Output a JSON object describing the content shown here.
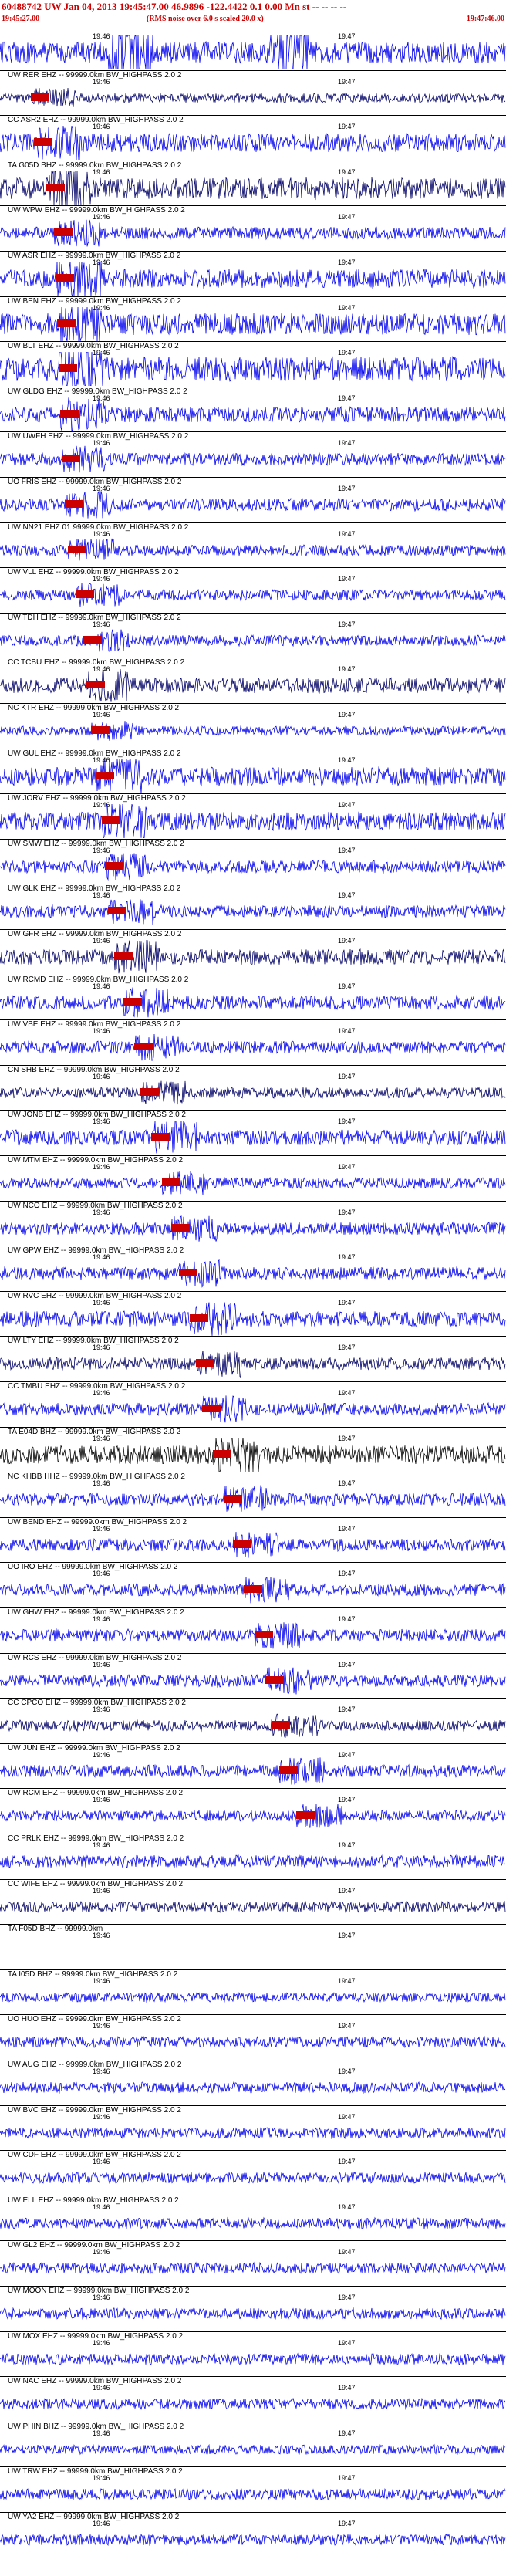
{
  "header": {
    "line1": "60488742 UW Jan 04, 2013 19:45:47.00   46.9896 -122.4422  0.1 0.00 Mn st -- -- -- --",
    "start_time": "19:45:27.00",
    "note": "(RMS noise over 6.0 s scaled 20.0 x)",
    "end_time": "19:47:46.00"
  },
  "tick_left": "19:46",
  "tick_right": "19:47",
  "colors": {
    "header_red": "#cc0000",
    "trace_blue": "#0000ee",
    "trace_navy": "#000066",
    "trace_black": "#000000",
    "pick_red": "#cc0000"
  },
  "stations": [
    {
      "label": "",
      "color": "#0000ee"
    },
    {
      "label": "UW RER EHZ -- 99999.0km BW_HIGHPASS  2.0  2",
      "color": "#000066"
    },
    {
      "label": "CC ASR2 EHZ -- 99999.0km BW_HIGHPASS  2.0  2",
      "color": "#0000ee"
    },
    {
      "label": "TA G05D BHZ -- 99999.0km BW_HIGHPASS  2.0  2",
      "color": "#000066"
    },
    {
      "label": "UW WPW EHZ -- 99999.0km BW_HIGHPASS  2.0  2",
      "color": "#0000ee"
    },
    {
      "label": "UW ASR EHZ -- 99999.0km BW_HIGHPASS  2.0  2",
      "color": "#0000ee"
    },
    {
      "label": "UW BEN EHZ -- 99999.0km BW_HIGHPASS  2.0  2",
      "color": "#0000ee"
    },
    {
      "label": "UW BLT EHZ -- 99999.0km BW_HIGHPASS  2.0  2",
      "color": "#0000ee"
    },
    {
      "label": "UW GLDG EHZ -- 99999.0km BW_HIGHPASS  2.0  2",
      "color": "#0000ee"
    },
    {
      "label": "UW UWFH EHZ -- 99999.0km BW_HIGHPASS  2.0  2",
      "color": "#0000ee"
    },
    {
      "label": "UO FRIS EHZ -- 99999.0km BW_HIGHPASS  2.0  2",
      "color": "#0000ee"
    },
    {
      "label": "UW NN21 EHZ 01 99999.0km BW_HIGHPASS  2.0  2",
      "color": "#0000ee"
    },
    {
      "label": "UW VLL EHZ -- 99999.0km BW_HIGHPASS  2.0  2",
      "color": "#0000ee"
    },
    {
      "label": "UW TDH EHZ -- 99999.0km BW_HIGHPASS  2.0  2",
      "color": "#0000ee"
    },
    {
      "label": "CC TCBU EHZ -- 99999.0km BW_HIGHPASS  2.0  2",
      "color": "#000066"
    },
    {
      "label": "NC KTR EHZ -- 99999.0km BW_HIGHPASS  2.0  2",
      "color": "#0000ee"
    },
    {
      "label": "UW GUL EHZ -- 99999.0km BW_HIGHPASS  2.0  2",
      "color": "#0000ee"
    },
    {
      "label": "UW JORV EHZ -- 99999.0km BW_HIGHPASS  2.0  2",
      "color": "#0000ee"
    },
    {
      "label": "UW SMW EHZ -- 99999.0km BW_HIGHPASS  2.0  2",
      "color": "#0000ee"
    },
    {
      "label": "UW GLK EHZ -- 99999.0km BW_HIGHPASS  2.0  2",
      "color": "#0000ee"
    },
    {
      "label": "UW GFR EHZ -- 99999.0km BW_HIGHPASS  2.0  2",
      "color": "#000066"
    },
    {
      "label": "UW RCMD EHZ -- 99999.0km BW_HIGHPASS  2.0  2",
      "color": "#0000ee"
    },
    {
      "label": "UW VBE EHZ -- 99999.0km BW_HIGHPASS  2.0  2",
      "color": "#0000ee"
    },
    {
      "label": "CN SHB EHZ -- 99999.0km BW_HIGHPASS  2.0  2",
      "color": "#000066"
    },
    {
      "label": "UW JONB EHZ -- 99999.0km BW_HIGHPASS  2.0  2",
      "color": "#0000ee"
    },
    {
      "label": "UW MTM EHZ -- 99999.0km BW_HIGHPASS  2.0  2",
      "color": "#0000ee"
    },
    {
      "label": "UW NCO EHZ -- 99999.0km BW_HIGHPASS  2.0  2",
      "color": "#0000ee"
    },
    {
      "label": "UW GPW EHZ -- 99999.0km BW_HIGHPASS  2.0  2",
      "color": "#0000ee"
    },
    {
      "label": "UW RVC EHZ -- 99999.0km BW_HIGHPASS  2.0  2",
      "color": "#0000ee"
    },
    {
      "label": "UW LTY EHZ -- 99999.0km BW_HIGHPASS  2.0  2",
      "color": "#000066"
    },
    {
      "label": "CC TMBU EHZ -- 99999.0km BW_HIGHPASS  2.0  2",
      "color": "#0000ee"
    },
    {
      "label": "TA E04D BHZ -- 99999.0km BW_HIGHPASS  2.0  2",
      "color": "#000000"
    },
    {
      "label": "NC KHBB HHZ -- 99999.0km BW_HIGHPASS  2.0  2",
      "color": "#0000ee"
    },
    {
      "label": "UW BEND EHZ -- 99999.0km BW_HIGHPASS  2.0  2",
      "color": "#0000ee"
    },
    {
      "label": "UO IRO EHZ -- 99999.0km BW_HIGHPASS  2.0  2",
      "color": "#0000ee"
    },
    {
      "label": "UW GHW EHZ -- 99999.0km BW_HIGHPASS  2.0  2",
      "color": "#0000ee"
    },
    {
      "label": "UW RCS EHZ -- 99999.0km BW_HIGHPASS  2.0  2",
      "color": "#0000ee"
    },
    {
      "label": "CC CPCO EHZ -- 99999.0km BW_HIGHPASS  2.0  2",
      "color": "#000066"
    },
    {
      "label": "UW JUN EHZ -- 99999.0km BW_HIGHPASS  2.0  2",
      "color": "#0000ee"
    },
    {
      "label": "UW RCM EHZ -- 99999.0km BW_HIGHPASS  2.0  2",
      "color": "#0000ee"
    },
    {
      "label": "CC PRLK EHZ -- 99999.0km BW_HIGHPASS  2.0  2",
      "color": "#0000ee"
    },
    {
      "label": "CC WIFE EHZ -- 99999.0km BW_HIGHPASS  2.0  2",
      "color": "#000066"
    },
    {
      "label": "TA F05D BHZ -- 99999.0km",
      "color": "#ffffff"
    },
    {
      "label": "TA I05D BHZ -- 99999.0km BW_HIGHPASS  2.0  2",
      "color": "#0000ee"
    },
    {
      "label": "UO HUO EHZ -- 99999.0km BW_HIGHPASS  2.0  2",
      "color": "#0000ee"
    },
    {
      "label": "UW AUG EHZ -- 99999.0km BW_HIGHPASS  2.0  2",
      "color": "#0000ee"
    },
    {
      "label": "UW BVC EHZ -- 99999.0km BW_HIGHPASS  2.0  2",
      "color": "#0000ee"
    },
    {
      "label": "UW CDF EHZ -- 99999.0km BW_HIGHPASS  2.0  2",
      "color": "#0000ee"
    },
    {
      "label": "UW ELL EHZ -- 99999.0km BW_HIGHPASS  2.0  2",
      "color": "#0000ee"
    },
    {
      "label": "UW GL2 EHZ -- 99999.0km BW_HIGHPASS  2.0  2",
      "color": "#0000ee"
    },
    {
      "label": "UW MOON EHZ -- 99999.0km BW_HIGHPASS  2.0  2",
      "color": "#0000ee"
    },
    {
      "label": "UW MOX EHZ -- 99999.0km BW_HIGHPASS  2.0  2",
      "color": "#0000ee"
    },
    {
      "label": "UW NAC EHZ -- 99999.0km BW_HIGHPASS  2.0  2",
      "color": "#0000ee"
    },
    {
      "label": "UW PHIN BHZ -- 99999.0km BW_HIGHPASS  2.0  2",
      "color": "#0000ee"
    },
    {
      "label": "UW TRW EHZ -- 99999.0km BW_HIGHPASS  2.0  2",
      "color": "#0000ee"
    },
    {
      "label": "UW YA2 EHZ -- 99999.0km BW_HIGHPASS  2.0  2",
      "color": "#0000ee"
    }
  ]
}
